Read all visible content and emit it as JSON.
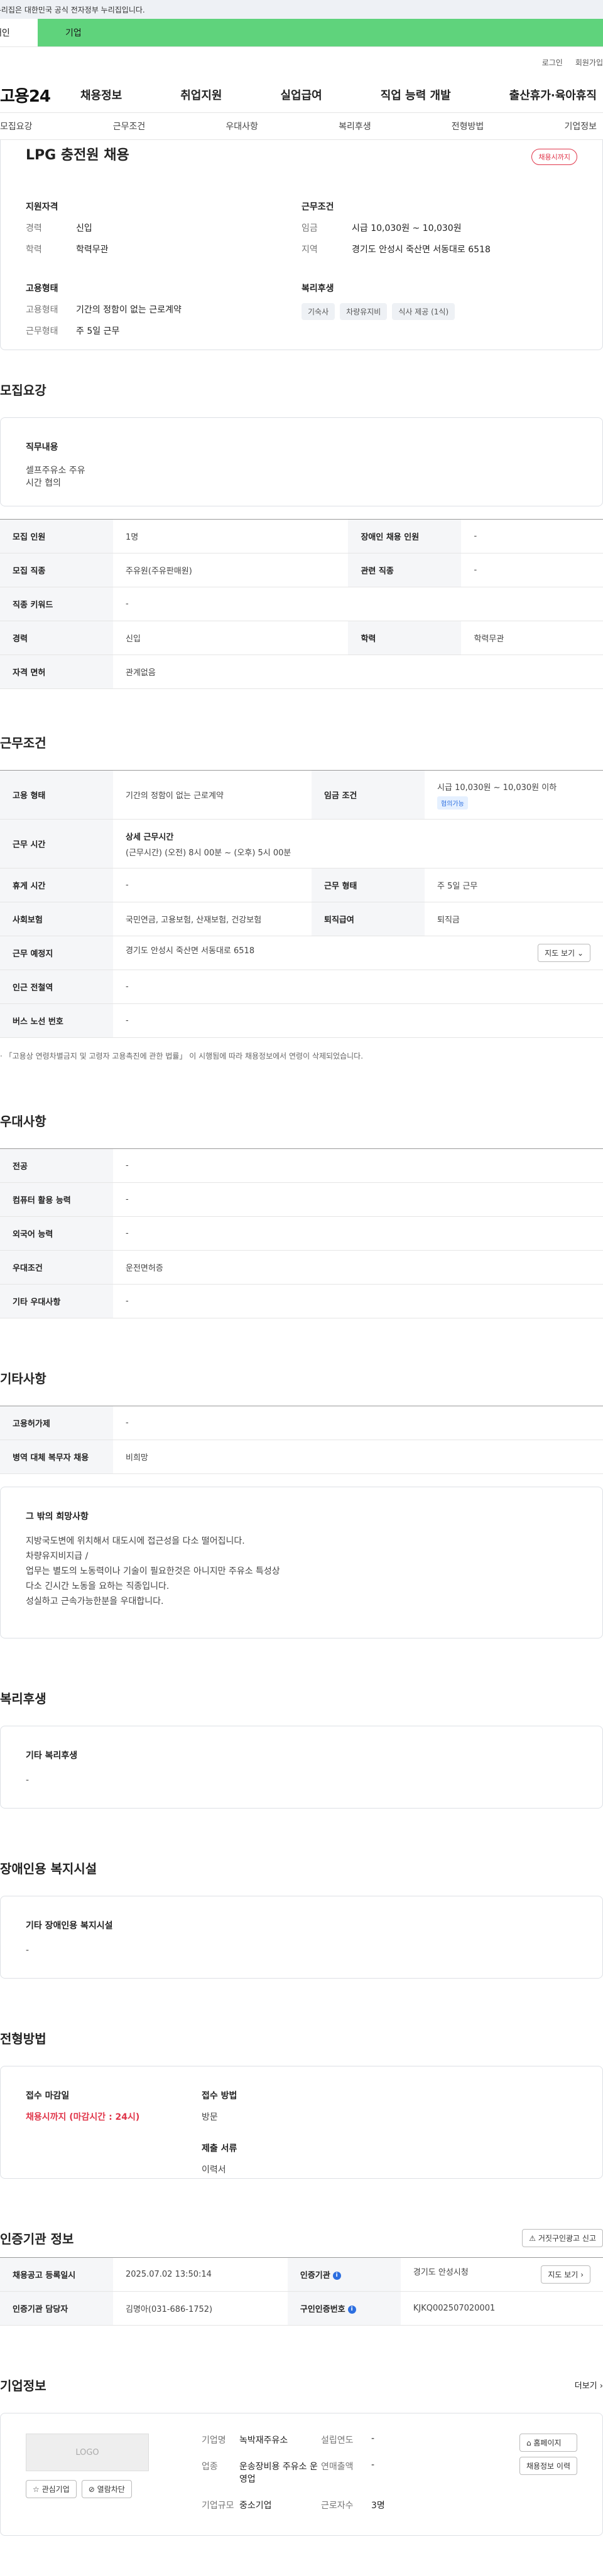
{
  "topbar": {
    "notice": "이 누리집은 대한민국 공식 전자정부 누리집입니다."
  },
  "tabs": {
    "personal": "개인",
    "company": "기업"
  },
  "util": {
    "login": "로그인",
    "signup": "회원가입"
  },
  "gnb": {
    "logo": "고용24",
    "menu": [
      "채용정보",
      "취업지원",
      "실업급여",
      "직업 능력 개발",
      "출산휴가·육아휴직"
    ]
  },
  "lnb": [
    "모집요강",
    "근무조건",
    "우대사항",
    "복리후생",
    "전형방법",
    "기업정보"
  ],
  "summary": {
    "title": "LPG 충전원 채용",
    "status": "채용시까지",
    "qual_title": "지원자격",
    "career_k": "경력",
    "career_v": "신입",
    "edu_k": "학력",
    "edu_v": "학력무관",
    "emp_title": "고용형태",
    "emptype_k": "고용형태",
    "emptype_v": "기간의 정함이 없는 근로계약",
    "worktype_k": "근무형태",
    "worktype_v": "주 5일 근무",
    "cond_title": "근무조건",
    "wage_k": "임금",
    "wage_v": "시급 10,030원 ~ 10,030원",
    "region_k": "지역",
    "region_v": "경기도 안성시 죽산면 서동대로 6518",
    "welfare_title": "복리후생",
    "welfare_chips": [
      "기숙사",
      "차량유지비",
      "식사 제공 (1식)"
    ]
  },
  "recruit": {
    "heading": "모집요강",
    "job_title": "직무내용",
    "job_text": [
      "셀프주유소 주유",
      "시간 협의"
    ],
    "rows": [
      [
        "모집 인원",
        "1명",
        "장애인 채용 인원",
        "-"
      ],
      [
        "모집 직종",
        "주유원(주유판매원)",
        "관련 직종",
        "-"
      ],
      [
        "직종 키워드",
        "-"
      ],
      [
        "경력",
        "신입",
        "학력",
        "학력무관"
      ],
      [
        "자격 면허",
        "관계없음"
      ]
    ]
  },
  "work": {
    "heading": "근무조건",
    "emptype_h": "고용 형태",
    "emptype_v": "기간의 정함이 없는 근로계약",
    "wage_h": "임금 조건",
    "wage_v": "시급 10,030원 ~ 10,030원 이하",
    "wage_badge": "협의가능",
    "hours_h": "근무 시간",
    "hours_title": "상세 근무시간",
    "hours_v": "(근무시간) (오전) 8시 00분 ~ (오후) 5시 00분",
    "rest_h": "휴게 시간",
    "rest_v": "-",
    "form_h": "근무 형태",
    "form_v": "주 5일 근무",
    "ins_h": "사회보험",
    "ins_v": "국민연금, 고용보험, 산재보험, 건강보험",
    "sev_h": "퇴직급여",
    "sev_v": "퇴직금",
    "place_h": "근무 예정지",
    "place_v": "경기도 안성시 죽산면 서동대로 6518",
    "map_btn": "지도 보기",
    "subway_h": "인근 전철역",
    "subway_v": "-",
    "bus_h": "버스 노선 번호",
    "bus_v": "-",
    "note": "「고용상 연령차별금지 및 고령자 고용촉진에 관한 법률」 이 시행됨에 따라 채용정보에서 연령이 삭제되었습니다."
  },
  "pref": {
    "heading": "우대사항",
    "rows": [
      [
        "전공",
        "-"
      ],
      [
        "컴퓨터 활용 능력",
        "-"
      ],
      [
        "외국어 능력",
        "-"
      ],
      [
        "우대조건",
        "운전면허증"
      ],
      [
        "기타 우대사항",
        "-"
      ]
    ]
  },
  "etc": {
    "heading": "기타사항",
    "rows": [
      [
        "고용허가제",
        "-"
      ],
      [
        "병역 대체 복무자 채용",
        "비희망"
      ]
    ],
    "box_title": "그 밖의 희망사항",
    "box_lines": [
      "지방국도변에 위치해서 대도시에 접근성을 다소 떨어집니다.",
      "차량유지비지급 /",
      "업무는 별도의 노동력이나 기술이 필요한것은 아니지만 주유소 특성상",
      "다소 긴시간 노동을 요하는 직종입니다.",
      "성실하고 근속가능한분을 우대합니다."
    ]
  },
  "welfare": {
    "heading": "복리후생",
    "box_title": "기타 복리후생",
    "box_value": "-"
  },
  "disab": {
    "heading": "장애인용 복지시설",
    "box_title": "기타 장애인용 복지시설",
    "box_value": "-"
  },
  "apply": {
    "heading": "전형방법",
    "deadline_l": "접수 마감일",
    "deadline_v": "채용시까지 (마감시간 : 24시)",
    "method_l": "접수 방법",
    "method_v": "방문",
    "docs_l": "제출 서류",
    "docs_v": "이력서"
  },
  "cert": {
    "heading": "인증기관 정보",
    "report_btn": "거짓구인광고 신고",
    "reg_h": "채용공고 등록일시",
    "reg_v": "2025.07.02 13:50:14",
    "org_h": "인증기관",
    "org_v": "경기도 안성시청",
    "map_btn": "지도 보기",
    "mgr_h": "인증기관 담당자",
    "mgr_v": "김명아(031-686-1752)",
    "no_h": "구인인증번호",
    "no_v": "KJKQ002507020001"
  },
  "company": {
    "heading": "기업정보",
    "more": "더보기",
    "logo": "LOGO",
    "fav_btn": "관심기업",
    "block_btn": "열람차단",
    "name_k": "기업명",
    "name_v": "녹박재주유소",
    "year_k": "설립연도",
    "year_v": "-",
    "ind_k": "업종",
    "ind_v": "운송장비용 주유소 운영업",
    "sales_k": "연매출액",
    "sales_v": "-",
    "size_k": "기업규모",
    "size_v": "중소기업",
    "emp_k": "근로자수",
    "emp_v": "3명",
    "home_btn": "홈페이지",
    "history_btn": "채용정보 이력"
  }
}
